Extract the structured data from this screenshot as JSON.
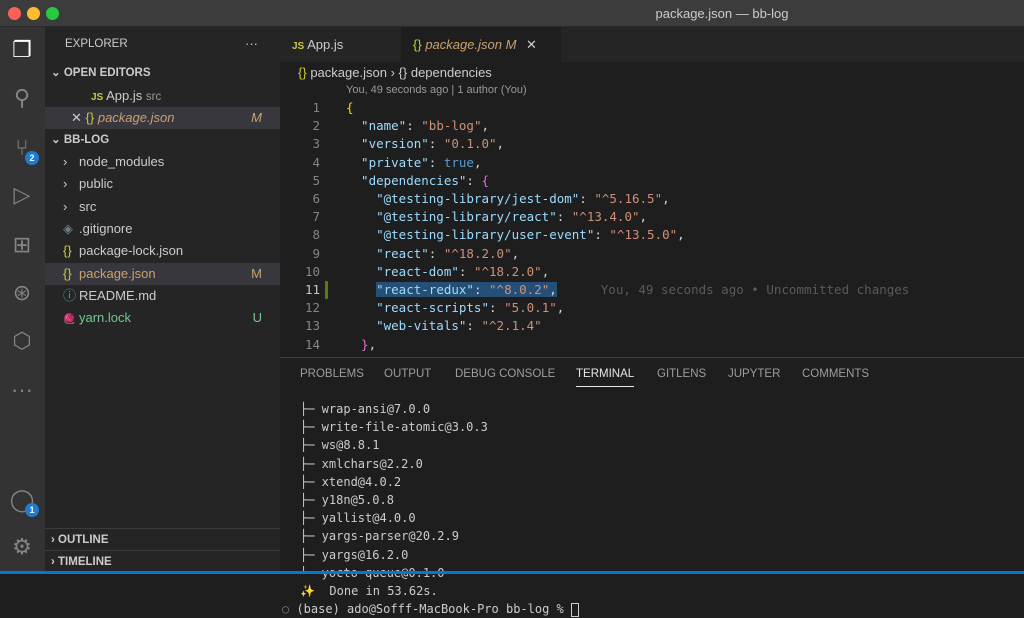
{
  "window": {
    "title": "package.json — bb-log"
  },
  "activity_bar": {
    "source_control_badge": "2",
    "accounts_badge": "1"
  },
  "explorer": {
    "title": "EXPLORER",
    "more": "···",
    "open_editors": {
      "label": "OPEN EDITORS",
      "items": [
        {
          "name": "App.js",
          "desc": "src",
          "icon": "JS"
        },
        {
          "name": "package.json",
          "status": "M",
          "icon": "{}"
        }
      ]
    },
    "project": {
      "label": "BB-LOG",
      "items": [
        {
          "name": "node_modules",
          "type": "folder"
        },
        {
          "name": "public",
          "type": "folder"
        },
        {
          "name": "src",
          "type": "folder"
        },
        {
          "name": ".gitignore",
          "type": "file"
        },
        {
          "name": "package-lock.json",
          "type": "json"
        },
        {
          "name": "package.json",
          "type": "json",
          "status": "M"
        },
        {
          "name": "README.md",
          "type": "info"
        },
        {
          "name": "yarn.lock",
          "type": "yarn",
          "status": "U"
        }
      ]
    },
    "outline": "OUTLINE",
    "timeline": "TIMELINE"
  },
  "tabs": [
    {
      "label": "App.js",
      "icon": "JS"
    },
    {
      "label": "package.json",
      "icon": "{}",
      "status": "M",
      "active": true
    }
  ],
  "breadcrumb": {
    "file": "package.json",
    "symbol": "dependencies"
  },
  "codelens": "You, 49 seconds ago | 1 author (You)",
  "code": {
    "current_line": 11,
    "blame": "You, 49 seconds ago • Uncommitted changes",
    "lines": [
      [
        [
          "br",
          "{"
        ]
      ],
      [
        [
          "k",
          "  \"name\""
        ],
        [
          "p",
          ": "
        ],
        [
          "s",
          "\"bb-log\""
        ],
        [
          "p",
          ","
        ]
      ],
      [
        [
          "k",
          "  \"version\""
        ],
        [
          "p",
          ": "
        ],
        [
          "s",
          "\"0.1.0\""
        ],
        [
          "p",
          ","
        ]
      ],
      [
        [
          "k",
          "  \"private\""
        ],
        [
          "p",
          ": "
        ],
        [
          "b",
          "true"
        ],
        [
          "p",
          ","
        ]
      ],
      [
        [
          "k",
          "  \"dependencies\""
        ],
        [
          "p",
          ": "
        ],
        [
          "br2",
          "{"
        ]
      ],
      [
        [
          "k",
          "    \"@testing-library/jest-dom\""
        ],
        [
          "p",
          ": "
        ],
        [
          "s",
          "\"^5.16.5\""
        ],
        [
          "p",
          ","
        ]
      ],
      [
        [
          "k",
          "    \"@testing-library/react\""
        ],
        [
          "p",
          ": "
        ],
        [
          "s",
          "\"^13.4.0\""
        ],
        [
          "p",
          ","
        ]
      ],
      [
        [
          "k",
          "    \"@testing-library/user-event\""
        ],
        [
          "p",
          ": "
        ],
        [
          "s",
          "\"^13.5.0\""
        ],
        [
          "p",
          ","
        ]
      ],
      [
        [
          "k",
          "    \"react\""
        ],
        [
          "p",
          ": "
        ],
        [
          "s",
          "\"^18.2.0\""
        ],
        [
          "p",
          ","
        ]
      ],
      [
        [
          "k",
          "    \"react-dom\""
        ],
        [
          "p",
          ": "
        ],
        [
          "s",
          "\"^18.2.0\""
        ],
        [
          "p",
          ","
        ]
      ],
      [
        [
          "k",
          "    \"react-redux\""
        ],
        [
          "p",
          ": "
        ],
        [
          "s",
          "\"^8.0.2\""
        ],
        [
          "p",
          ","
        ]
      ],
      [
        [
          "k",
          "    \"react-scripts\""
        ],
        [
          "p",
          ": "
        ],
        [
          "s",
          "\"5.0.1\""
        ],
        [
          "p",
          ","
        ]
      ],
      [
        [
          "k",
          "    \"web-vitals\""
        ],
        [
          "p",
          ": "
        ],
        [
          "s",
          "\"^2.1.4\""
        ]
      ],
      [
        [
          "br2",
          "  }"
        ],
        [
          "p",
          ","
        ]
      ]
    ]
  },
  "panel": {
    "tabs": [
      "PROBLEMS",
      "OUTPUT",
      "DEBUG CONSOLE",
      "TERMINAL",
      "GITLENS",
      "JUPYTER",
      "COMMENTS"
    ],
    "active": "TERMINAL"
  },
  "terminal": {
    "lines": [
      "├─ wrap-ansi@7.0.0",
      "├─ write-file-atomic@3.0.3",
      "├─ ws@8.8.1",
      "├─ xmlchars@2.2.0",
      "├─ xtend@4.0.2",
      "├─ y18n@5.0.8",
      "├─ yallist@4.0.0",
      "├─ yargs-parser@20.2.9",
      "├─ yargs@16.2.0",
      "└─ yocto-queue@0.1.0",
      "✨  Done in 53.62s."
    ],
    "prompt": "(base) ado@Sofff-MacBook-Pro bb-log % "
  },
  "colors": {
    "accent": "#007acc",
    "modified": "#c9a26d",
    "untracked": "#73c991"
  }
}
